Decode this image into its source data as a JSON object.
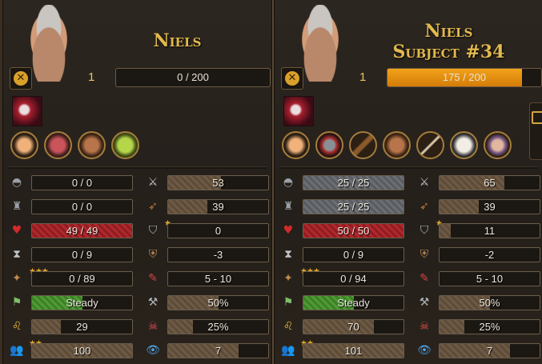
{
  "panels": [
    {
      "name_lines": [
        "Niels"
      ],
      "level": "1",
      "xp_text": "0 / 200",
      "xp_fraction": 0,
      "perk_icons": [
        "hand-icon",
        "lungs-icon",
        "ogre-icon",
        "goblin-icon"
      ],
      "left_stats": [
        {
          "icon": "helmet-icon",
          "text": "0 / 0",
          "fill": 0,
          "color": "brown",
          "stars": ""
        },
        {
          "icon": "armor-icon",
          "text": "0 / 0",
          "fill": 0,
          "color": "brown",
          "stars": ""
        },
        {
          "icon": "heart-icon",
          "text": "49 / 49",
          "fill": 1,
          "color": "red",
          "stars": ""
        },
        {
          "icon": "hourglass-icon",
          "text": "0 / 9",
          "fill": 0,
          "color": "brown",
          "stars": ""
        },
        {
          "icon": "fatigue-icon",
          "text": "0 / 89",
          "fill": 0,
          "color": "brown",
          "stars": "★★★"
        },
        {
          "icon": "flag-icon",
          "text": "Steady",
          "fill": 0.5,
          "color": "green",
          "stars": ""
        },
        {
          "icon": "lion-icon",
          "text": "29",
          "fill": 0.29,
          "color": "brown",
          "stars": ""
        },
        {
          "icon": "people-icon",
          "text": "100",
          "fill": 1,
          "color": "brown",
          "stars": "★★"
        }
      ],
      "right_stats": [
        {
          "icon": "sword-icon",
          "text": "53",
          "fill": 0.53,
          "stars": ""
        },
        {
          "icon": "bow-icon",
          "text": "39",
          "fill": 0.39,
          "stars": ""
        },
        {
          "icon": "shield-icon",
          "text": "0",
          "fill": 0,
          "stars": "★"
        },
        {
          "icon": "ranged-defense-icon",
          "text": "-3",
          "fill": 0,
          "stars": ""
        },
        {
          "icon": "damage-icon",
          "text": "5 - 10",
          "fill": 0,
          "stars": ""
        },
        {
          "icon": "armor-damage-icon",
          "text": "50%",
          "fill": 0.5,
          "stars": ""
        },
        {
          "icon": "skull-icon",
          "text": "25%",
          "fill": 0.25,
          "stars": ""
        },
        {
          "icon": "eye-icon",
          "text": "7",
          "fill": 0.7,
          "stars": ""
        }
      ]
    },
    {
      "name_lines": [
        "Niels",
        "Subject #34"
      ],
      "level": "1",
      "xp_text": "175 / 200",
      "xp_fraction": 0.875,
      "perk_icons": [
        "hand-icon",
        "demon-icon",
        "club-icon",
        "ogre-icon",
        "arrow-icon",
        "mask-icon",
        "fist-icon"
      ],
      "left_stats": [
        {
          "icon": "helmet-icon",
          "text": "25 / 25",
          "fill": 1,
          "color": "gray",
          "stars": ""
        },
        {
          "icon": "armor-icon",
          "text": "25 / 25",
          "fill": 1,
          "color": "gray",
          "stars": ""
        },
        {
          "icon": "heart-icon",
          "text": "50 / 50",
          "fill": 1,
          "color": "red",
          "stars": ""
        },
        {
          "icon": "hourglass-icon",
          "text": "0 / 9",
          "fill": 0,
          "color": "brown",
          "stars": ""
        },
        {
          "icon": "fatigue-icon",
          "text": "0 / 94",
          "fill": 0,
          "color": "brown",
          "stars": "★★★"
        },
        {
          "icon": "flag-icon",
          "text": "Steady",
          "fill": 0.5,
          "color": "green",
          "stars": ""
        },
        {
          "icon": "lion-icon",
          "text": "70",
          "fill": 0.7,
          "color": "brown",
          "stars": ""
        },
        {
          "icon": "people-icon",
          "text": "101",
          "fill": 1,
          "color": "brown",
          "stars": "★★"
        }
      ],
      "right_stats": [
        {
          "icon": "sword-icon",
          "text": "65",
          "fill": 0.65,
          "stars": ""
        },
        {
          "icon": "bow-icon",
          "text": "39",
          "fill": 0.39,
          "stars": ""
        },
        {
          "icon": "shield-icon",
          "text": "11",
          "fill": 0.11,
          "stars": "★"
        },
        {
          "icon": "ranged-defense-icon",
          "text": "-2",
          "fill": 0,
          "stars": ""
        },
        {
          "icon": "damage-icon",
          "text": "5 - 10",
          "fill": 0,
          "stars": ""
        },
        {
          "icon": "armor-damage-icon",
          "text": "50%",
          "fill": 0.5,
          "stars": ""
        },
        {
          "icon": "skull-icon",
          "text": "25%",
          "fill": 0.25,
          "stars": ""
        },
        {
          "icon": "eye-icon",
          "text": "7",
          "fill": 0.7,
          "stars": ""
        }
      ]
    }
  ],
  "icon_glyphs": {
    "helmet-icon": "◓",
    "armor-icon": "♜",
    "heart-icon": "♥",
    "hourglass-icon": "⧗",
    "fatigue-icon": "✦",
    "flag-icon": "⚑",
    "lion-icon": "♌",
    "people-icon": "👥",
    "sword-icon": "⚔",
    "bow-icon": "➶",
    "shield-icon": "⛉",
    "ranged-defense-icon": "⛨",
    "damage-icon": "✎",
    "armor-damage-icon": "⚒",
    "skull-icon": "☠",
    "eye-icon": "👁"
  },
  "icon_colors": {
    "helmet-icon": "#9aa0a6",
    "armor-icon": "#9aa0a6",
    "heart-icon": "#d22a2a",
    "hourglass-icon": "#bfc4c8",
    "fatigue-icon": "#c08a4a",
    "flag-icon": "#7fbf6a",
    "lion-icon": "#e4b83a",
    "people-icon": "#e4b83a",
    "sword-icon": "#c7ccd1",
    "bow-icon": "#b5793c",
    "shield-icon": "#b0b4b8",
    "ranged-defense-icon": "#b78a55",
    "damage-icon": "#d34444",
    "armor-damage-icon": "#b0b4b8",
    "skull-icon": "#e05050",
    "eye-icon": "#4da3e6"
  },
  "colors": {
    "name": "#e2b94c",
    "xp": "#f2a21a",
    "stars": "#e7ad2a"
  }
}
